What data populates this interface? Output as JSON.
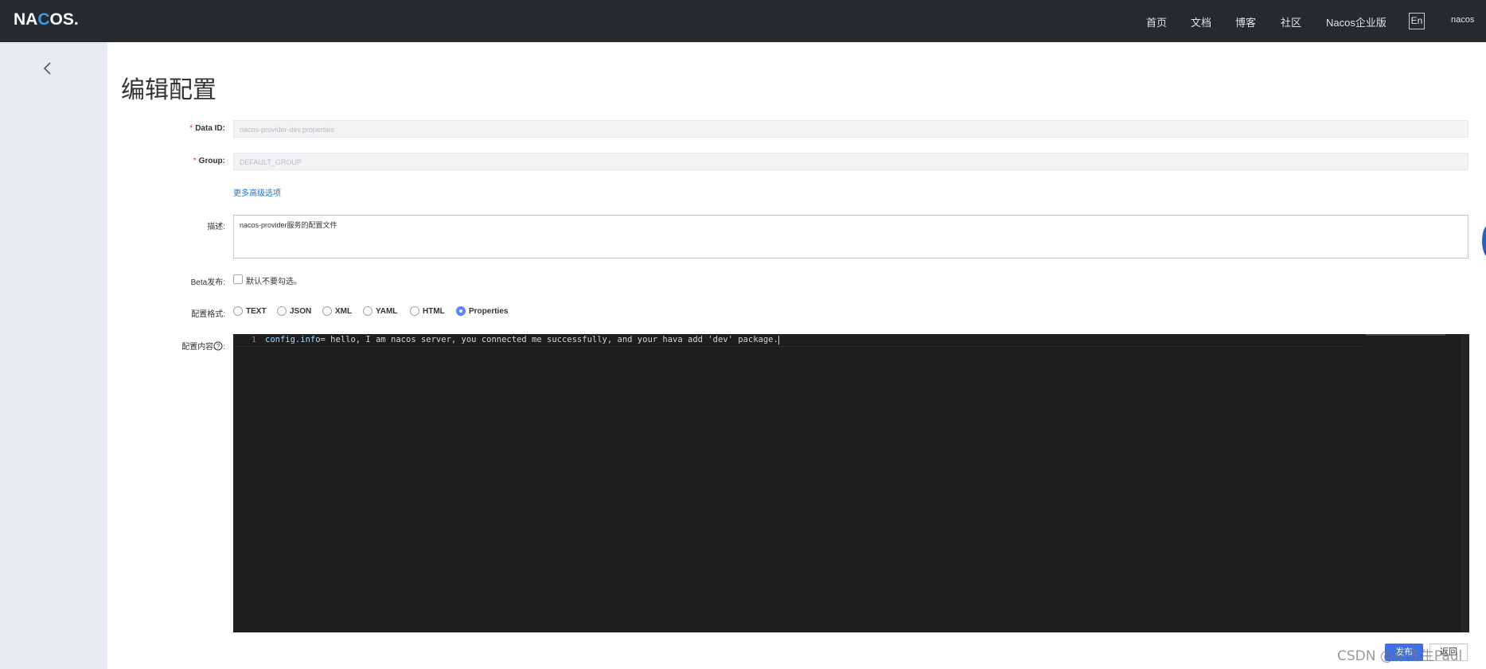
{
  "header": {
    "logo": "NACOS.",
    "nav": [
      "首页",
      "文档",
      "博客",
      "社区",
      "Nacos企业版"
    ],
    "lang": "En",
    "user": "nacos"
  },
  "page": {
    "title": "编辑配置"
  },
  "form": {
    "data_id": {
      "label": "Data ID:",
      "value": "nacos-provider-dev.properties"
    },
    "group": {
      "label": "Group:",
      "value": "DEFAULT_GROUP"
    },
    "advanced_link": "更多高级选项",
    "description": {
      "label": "描述:",
      "value": "nacos-provider服务的配置文件"
    },
    "beta": {
      "label": "Beta发布:",
      "checkbox_label": "默认不要勾选。"
    },
    "format": {
      "label": "配置格式:",
      "options": [
        "TEXT",
        "JSON",
        "XML",
        "YAML",
        "HTML",
        "Properties"
      ],
      "selected": "Properties"
    },
    "content": {
      "label": "配置内容",
      "help_icon": "question-circle-icon",
      "line_number": "1",
      "code_key": "config.info=",
      "code_value": " hello, I am nacos server, you connected me successfully, and your hava add 'dev' package."
    }
  },
  "buttons": {
    "publish": "发布",
    "back": "返回"
  },
  "watermark": "CSDN @徐先生Paul",
  "colors": {
    "header_bg": "#252a2f",
    "primary": "#3c70e6",
    "required": "#e0362f",
    "link": "#2072d2"
  }
}
